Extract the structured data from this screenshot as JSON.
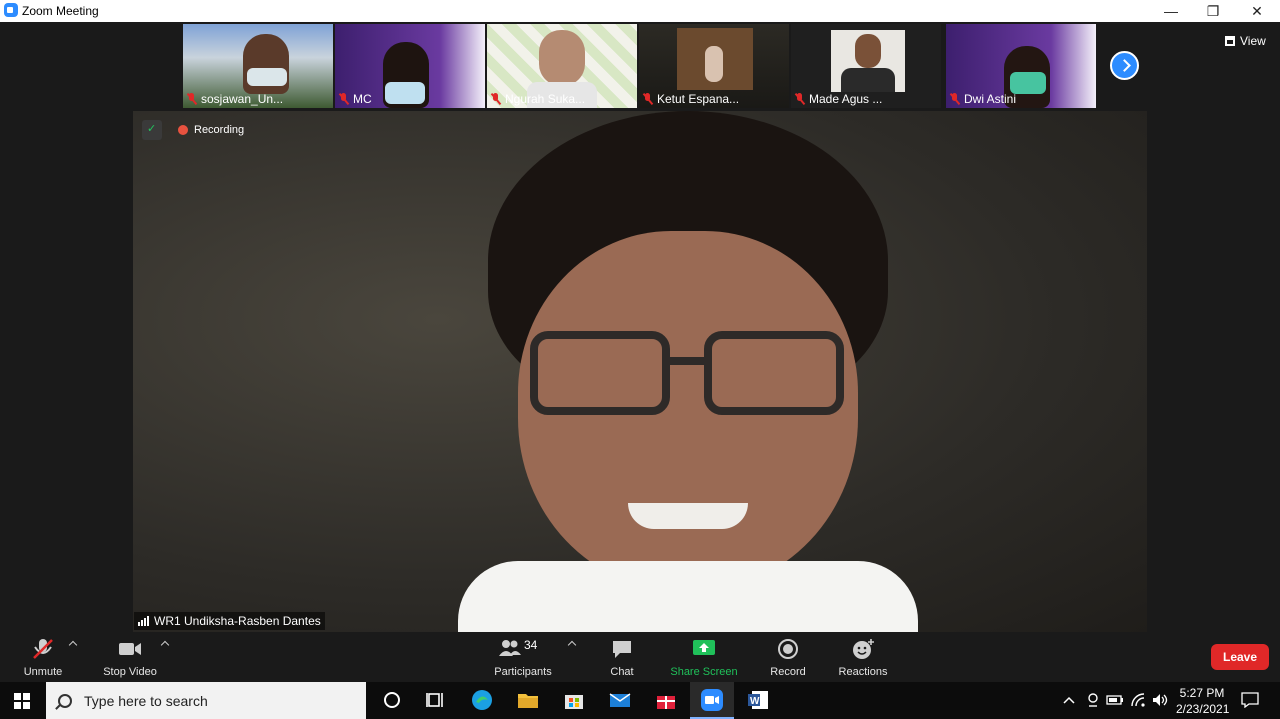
{
  "window": {
    "title": "Zoom Meeting",
    "minimize": "—",
    "restore": "❐",
    "close": "✕"
  },
  "gallery": {
    "participants": [
      {
        "name": "sosjawan_Un...",
        "bg": "#4f6a8a"
      },
      {
        "name": "MC",
        "bg": "#4a2a7a"
      },
      {
        "name": "Ngurah Suka...",
        "bg": "#dcdcd4"
      },
      {
        "name": "Ketut Espana...",
        "bg": "#2a2620"
      },
      {
        "name": "Made Agus ...",
        "bg": "#1f1f1f"
      },
      {
        "name": "Dwi Astini",
        "bg": "#4a2a7a"
      }
    ],
    "view_label": "View"
  },
  "main_video": {
    "recording_label": "Recording",
    "speaker_name": "WR1 Undiksha-Rasben Dantes"
  },
  "toolbar": {
    "unmute": "Unmute",
    "stop_video": "Stop Video",
    "participants": "Participants",
    "participants_count": "34",
    "chat": "Chat",
    "share_screen": "Share Screen",
    "record": "Record",
    "reactions": "Reactions",
    "leave": "Leave"
  },
  "taskbar": {
    "search_placeholder": "Type here to search",
    "time": "5:27 PM",
    "date": "2/23/2021"
  },
  "colors": {
    "accent": "#2d8cff",
    "share_green": "#20c05a",
    "leave_red": "#e02828"
  }
}
